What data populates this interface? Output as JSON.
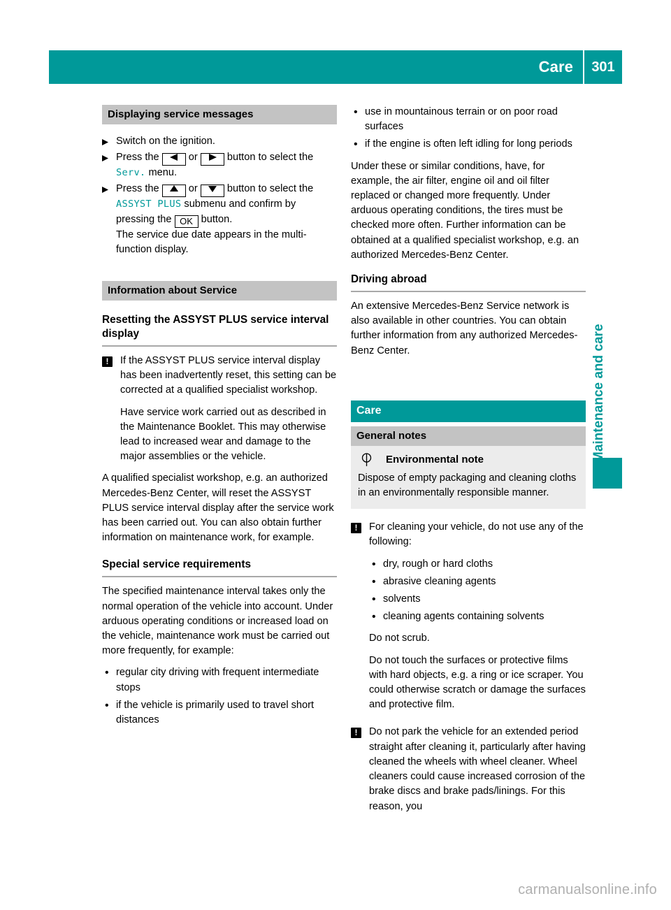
{
  "header": {
    "title": "Care",
    "page_number": "301"
  },
  "side_tab": {
    "label": "Maintenance and care"
  },
  "footer": {
    "watermark": "carmanualsonline.info"
  },
  "left_column": {
    "section1_heading": "Displaying service messages",
    "step1": "Switch on the ignition.",
    "step2_a": "Press the",
    "step2_or": "or",
    "step2_b": "button to select the",
    "step2_menu": "Serv.",
    "step2_c": "menu.",
    "step3_a": "Press the",
    "step3_or": "or",
    "step3_b": "button to select the",
    "step3_submenu": "ASSYST PLUS",
    "step3_c": "submenu and confirm by",
    "step3_d": "pressing the",
    "step3_key_ok": "OK",
    "step3_e": "button.",
    "step3_result": "The service due date appears in the multi-function display.",
    "section2_heading": "Information about Service",
    "subhead1": "Resetting the ASSYST PLUS service interval display",
    "notice1_p1": "If the ASSYST PLUS service interval display has been inadvertently reset, this setting can be corrected at a qualified specialist workshop.",
    "notice1_p2": "Have service work carried out as described in the Maintenance Booklet. This may otherwise lead to increased wear and damage to the major assemblies or the vehicle.",
    "para1": "A qualified specialist workshop, e.g. an authorized Mercedes-Benz Center, will reset the ASSYST PLUS service interval display after the service work has been carried out. You can also obtain further information on maintenance work, for example.",
    "subhead2": "Special service requirements",
    "para2": "The specified maintenance interval takes only the normal operation of the vehicle into account. Under arduous operating conditions or increased load on the vehicle, maintenance work must be carried out more frequently, for example:",
    "bullets": [
      "regular city driving with frequent intermediate stops",
      "if the vehicle is primarily used to travel short distances"
    ]
  },
  "right_column": {
    "bullets_top": [
      "use in mountainous terrain or on poor road surfaces",
      "if the engine is often left idling for long periods"
    ],
    "para1": "Under these or similar conditions, have, for example, the air filter, engine oil and oil filter replaced or changed more frequently. Under arduous operating conditions, the tires must be checked more often. Further information can be obtained at a qualified specialist workshop, e.g. an authorized Mercedes-Benz Center.",
    "subhead1": "Driving abroad",
    "para2": "An extensive Mercedes-Benz Service network is also available in other countries. You can obtain further information from any authorized Mercedes-Benz Center.",
    "section_heading": "Care",
    "subsection_heading": "General notes",
    "env_note_title": "Environmental note",
    "env_note_body": "Dispose of empty packaging and cleaning cloths in an environmentally responsible manner.",
    "notice1": "For cleaning your vehicle, do not use any of the following:",
    "notice1_bullets": [
      "dry, rough or hard cloths",
      "abrasive cleaning agents",
      "solvents",
      "cleaning agents containing solvents"
    ],
    "notice1_after": "Do not scrub.",
    "notice1_after2": "Do not touch the surfaces or protective films with hard objects, e.g. a ring or ice scraper. You could otherwise scratch or damage the surfaces and protective film.",
    "notice2": "Do not park the vehicle for an extended period straight after cleaning it, particularly after having cleaned the wheels with wheel cleaner. Wheel cleaners could cause increased corrosion of the brake discs and brake pads/linings. For this reason, you"
  },
  "icons": {
    "warning": "!",
    "bullet": "•"
  },
  "colors": {
    "teal": "#009999",
    "gray_bar": "#c3c3c3",
    "note_panel": "#ececec"
  }
}
